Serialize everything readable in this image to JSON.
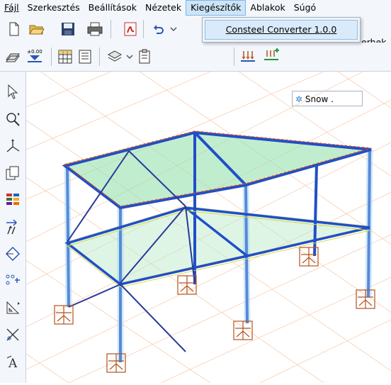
{
  "menubar": {
    "items": [
      "Fájl",
      "Szerkesztés",
      "Beállítások",
      "Nézetek",
      "Kiegészítők",
      "Ablakok",
      "Súgó"
    ],
    "active_index": 4
  },
  "dropdown": {
    "items": [
      "Consteel Converter 1.0.0"
    ]
  },
  "toolbar": {
    "partial_label": "erhek",
    "load_case": "Snow .",
    "level_label": "±0.00"
  },
  "colors": {
    "chrome": "#f3f6fb",
    "menu_highlight": "#cde4f7",
    "beam_blue": "#1f4fc8",
    "slab_green": "#8fe0a8",
    "grid_orange": "#f4b48a",
    "support_brown": "#b4521e"
  },
  "icons": {
    "toolbar_row1": [
      "new-document-icon",
      "open-folder-icon",
      "save-icon",
      "print-icon",
      "pdf-icon",
      "undo-icon",
      "chevron-down-icon"
    ],
    "toolbar_row2": [
      "plane-icon",
      "level-icon",
      "grid-icon",
      "table-icon",
      "layer-icon",
      "chevron-down-icon",
      "clipboard-icon",
      "load-icon",
      "add-load-icon",
      "snow-icon"
    ],
    "sidebar": [
      "pointer-icon",
      "zoom-icon",
      "axes-icon",
      "copy-icon",
      "color-palette-icon",
      "move-arrows-icon",
      "rotate-diamond-icon",
      "dimension-icon",
      "measure-icon",
      "cut-icon",
      "text-icon"
    ]
  }
}
